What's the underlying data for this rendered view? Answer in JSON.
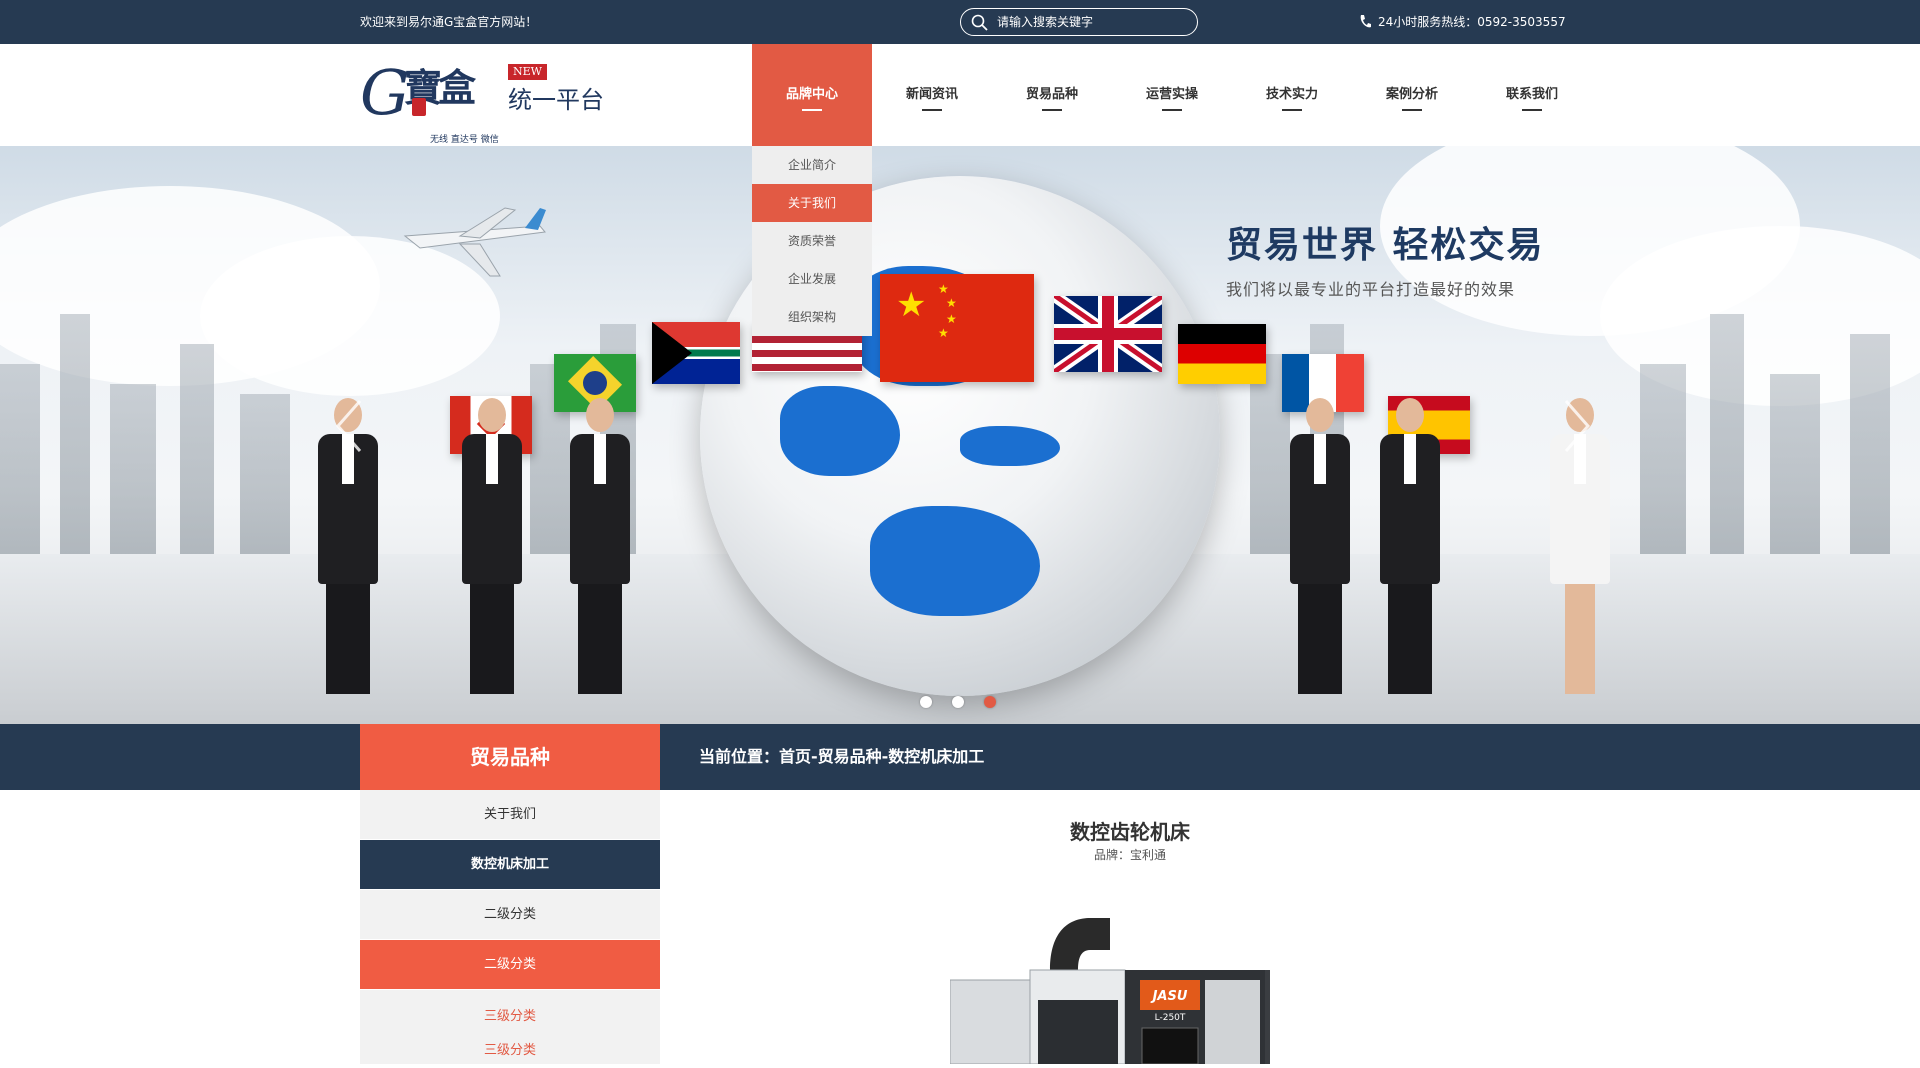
{
  "topbar": {
    "welcome": "欢迎来到易尔通G宝盒官方网站！",
    "search_placeholder": "请输入搜索关键字",
    "hotline": "24小时服务热线：0592-3503557"
  },
  "logo": {
    "letter": "G",
    "brand": "寶盒",
    "slogan": "统一平台",
    "badge": "NEW",
    "tagline": "无线  直达号  微信"
  },
  "nav": {
    "items": [
      {
        "label": "品牌中心"
      },
      {
        "label": "新闻资讯"
      },
      {
        "label": "贸易品种"
      },
      {
        "label": "运营实操"
      },
      {
        "label": "技术实力"
      },
      {
        "label": "案例分析"
      },
      {
        "label": "联系我们"
      }
    ]
  },
  "dropdown": {
    "items": [
      {
        "label": "企业简介"
      },
      {
        "label": "关于我们"
      },
      {
        "label": "资质荣誉"
      },
      {
        "label": "企业发展"
      },
      {
        "label": "组织架构"
      }
    ]
  },
  "banner": {
    "title": "贸易世界 轻松交易",
    "subtitle": "我们将以最专业的平台打造最好的效果",
    "slide_count": 3,
    "active_slide": 3
  },
  "section": {
    "title": "贸易品种",
    "breadcrumb": "当前位置：首页-贸易品种-数控机床加工"
  },
  "sidebar": {
    "items": [
      {
        "label": "关于我们"
      },
      {
        "label": "数控机床加工"
      },
      {
        "label": "二级分类"
      },
      {
        "label": "二级分类"
      }
    ],
    "subitems": [
      {
        "label": "三级分类"
      },
      {
        "label": "三级分类"
      }
    ]
  },
  "product": {
    "title": "数控齿轮机床",
    "brand": "品牌：宝利通",
    "machine_label": "JASU",
    "machine_model": "L-250T"
  },
  "colors": {
    "navy": "#263a52",
    "accent_red": "#e25a44",
    "section_red": "#f05c43"
  }
}
